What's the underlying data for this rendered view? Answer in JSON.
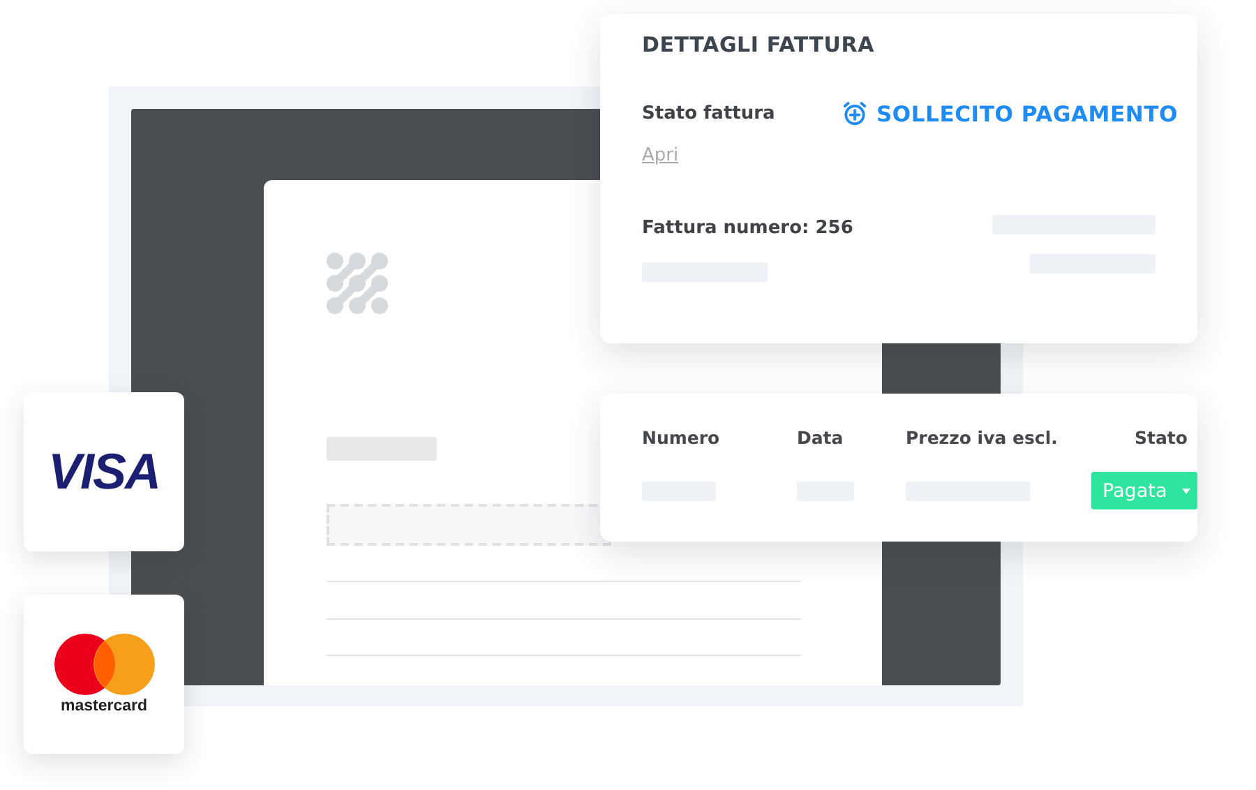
{
  "details": {
    "title": "DETTAGLI FATTURA",
    "status_label": "Stato fattura",
    "status_link": "Apri",
    "reminder_button": "SOLLECITO PAGAMENTO",
    "invoice_number": "Fattura numero: 256"
  },
  "table": {
    "columns": [
      "Numero",
      "Data",
      "Prezzo iva escl.",
      "Stato"
    ],
    "rows": [
      {
        "status": "Pagata",
        "color": "#2ee59d"
      }
    ]
  },
  "payment_cards": [
    {
      "kind": "visa",
      "label": "VISA"
    },
    {
      "kind": "mastercard",
      "label": "mastercard"
    }
  ]
}
